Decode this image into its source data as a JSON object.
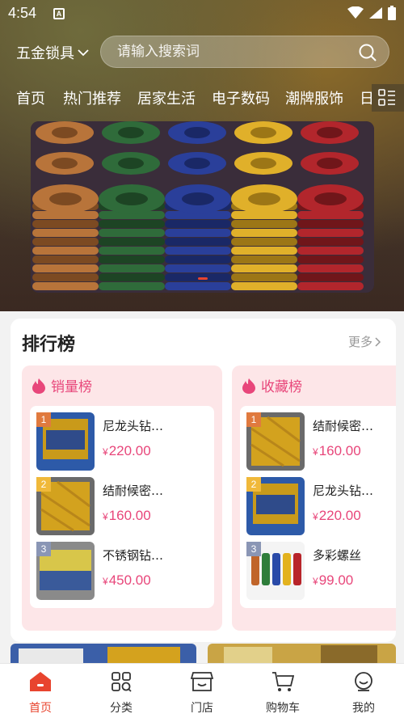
{
  "status_bar": {
    "time": "4:54",
    "notification_badge": "A"
  },
  "header": {
    "category_select": "五金锁具",
    "search_placeholder": "请输入搜索词"
  },
  "tabs": [
    "首页",
    "热门推荐",
    "居家生活",
    "电子数码",
    "潮牌服饰",
    "日"
  ],
  "banner": {
    "image": "colored-springs-photo"
  },
  "ranking": {
    "title": "排行榜",
    "more_label": "更多",
    "boards": [
      {
        "title": "销量榜",
        "items": [
          {
            "rank": "1",
            "name": "尼龙头钻…",
            "currency": "¥",
            "price": "220.00"
          },
          {
            "rank": "2",
            "name": "结耐候密…",
            "currency": "¥",
            "price": "160.00"
          },
          {
            "rank": "3",
            "name": "不锈钢钻…",
            "currency": "¥",
            "price": "450.00"
          }
        ]
      },
      {
        "title": "收藏榜",
        "items": [
          {
            "rank": "1",
            "name": "结耐候密…",
            "currency": "¥",
            "price": "160.00"
          },
          {
            "rank": "2",
            "name": "尼龙头钻…",
            "currency": "¥",
            "price": "220.00"
          },
          {
            "rank": "3",
            "name": "多彩螺丝",
            "currency": "¥",
            "price": "99.00"
          }
        ]
      }
    ]
  },
  "bottom_nav": [
    {
      "label": "首页",
      "icon": "home-icon",
      "active": true
    },
    {
      "label": "分类",
      "icon": "category-icon",
      "active": false
    },
    {
      "label": "门店",
      "icon": "store-icon",
      "active": false
    },
    {
      "label": "购物车",
      "icon": "cart-icon",
      "active": false
    },
    {
      "label": "我的",
      "icon": "profile-icon",
      "active": false
    }
  ],
  "colors": {
    "accent": "#e8442e",
    "price": "#e8467a",
    "board_bg": "#fde6e8"
  }
}
